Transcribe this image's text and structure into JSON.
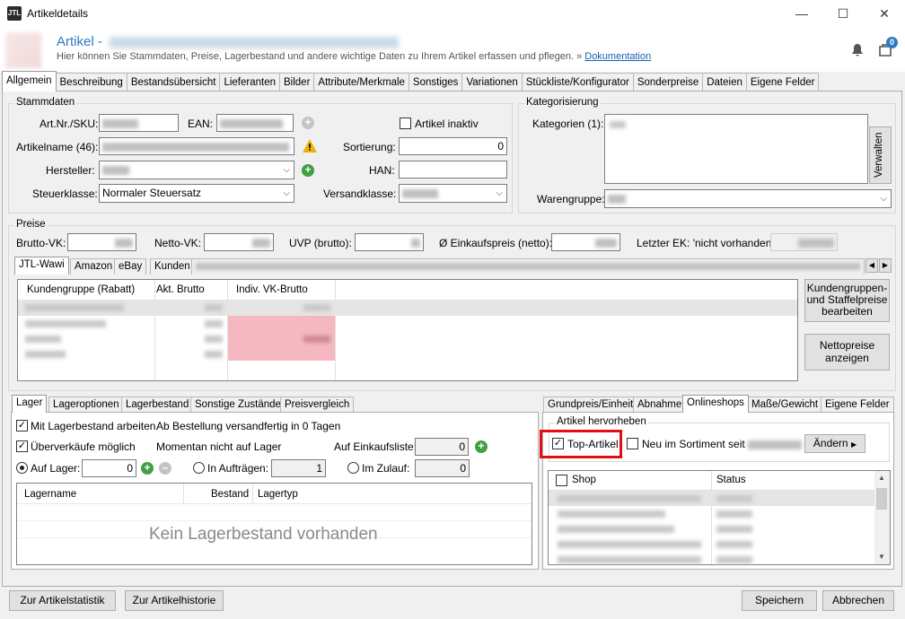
{
  "window": {
    "title": "Artikeldetails",
    "minimize": "—",
    "maximize": "☐",
    "close": "✕"
  },
  "header": {
    "title_prefix": "Artikel - ",
    "subtitle": "Hier können Sie Stammdaten, Preise, Lagerbestand und andere wichtige Daten zu Ihrem Artikel erfassen und pflegen. » ",
    "doc_link": "Dokumentation",
    "badge": "0",
    "accent": "#2c7bbf"
  },
  "tabs": [
    "Allgemein",
    "Beschreibung",
    "Bestandsübersicht",
    "Lieferanten",
    "Bilder",
    "Attribute/Merkmale",
    "Sonstiges",
    "Variationen",
    "Stückliste/Konfigurator",
    "Sonderpreise",
    "Dateien",
    "Eigene Felder"
  ],
  "stammdaten": {
    "legend": "Stammdaten",
    "artnr_label": "Art.Nr./SKU:",
    "ean_label": "EAN:",
    "inactive_label": "Artikel inaktiv",
    "name_label": "Artikelname (46):",
    "sort_label": "Sortierung:",
    "sort_value": "0",
    "hersteller_label": "Hersteller:",
    "han_label": "HAN:",
    "steuer_label": "Steuerklasse:",
    "steuer_value": "Normaler Steuersatz",
    "versand_label": "Versandklasse:"
  },
  "kategorisierung": {
    "legend": "Kategorisierung",
    "kat_label": "Kategorien (1):",
    "verwalten": "Verwalten",
    "warengruppe_label": "Warengruppe:"
  },
  "preise": {
    "legend": "Preise",
    "brutto_label": "Brutto-VK:",
    "netto_label": "Netto-VK:",
    "uvp_label": "UVP (brutto):",
    "ek_label": "Ø Einkaufspreis (netto):",
    "letzter_ek": "Letzter EK: 'nicht vorhanden'",
    "tabs": [
      "JTL-Wawi",
      "Amazon",
      "eBay",
      "Kunden"
    ],
    "cols": [
      "Kundengruppe (Rabatt)",
      "Akt. Brutto",
      "Indiv. VK-Brutto"
    ],
    "btn_staffel": "Kundengruppen- und Staffelpreise bearbeiten",
    "btn_netto": "Nettopreise anzeigen"
  },
  "lager": {
    "tabs": [
      "Lager",
      "Lageroptionen",
      "Lagerbestand",
      "Sonstige Zustände",
      "Preisvergleich"
    ],
    "mit_lager": "Mit Lagerbestand arbeiten",
    "ab_bestellung": "Ab Bestellung versandfertig in 0 Tagen",
    "ueberverkauf": "Überverkäufe möglich",
    "momentan": "Momentan nicht auf Lager",
    "einkaufsliste_label": "Auf Einkaufsliste:",
    "einkaufsliste_value": "0",
    "auf_lager_label": "Auf Lager:",
    "auf_lager_value": "0",
    "auftraegen_label": "In Aufträgen:",
    "auftraegen_value": "1",
    "zulauf_label": "Im Zulauf:",
    "zulauf_value": "0",
    "cols": [
      "Lagername",
      "Bestand",
      "Lagertyp"
    ],
    "empty": "Kein Lagerbestand vorhanden"
  },
  "online": {
    "tabs": [
      "Grundpreis/Einheit",
      "Abnahme",
      "Onlineshops",
      "Maße/Gewicht",
      "Eigene Felder"
    ],
    "legend": "Artikel hervorheben",
    "top_artikel": "Top-Artikel",
    "neu_label": "Neu im Sortiment seit",
    "aendern": "Ändern",
    "cols": [
      "Shop",
      "Status"
    ],
    "highlight": "#e01010"
  },
  "footer": {
    "statistik": "Zur Artikelstatistik",
    "historie": "Zur Artikelhistorie",
    "speichern": "Speichern",
    "abbrechen": "Abbrechen"
  }
}
